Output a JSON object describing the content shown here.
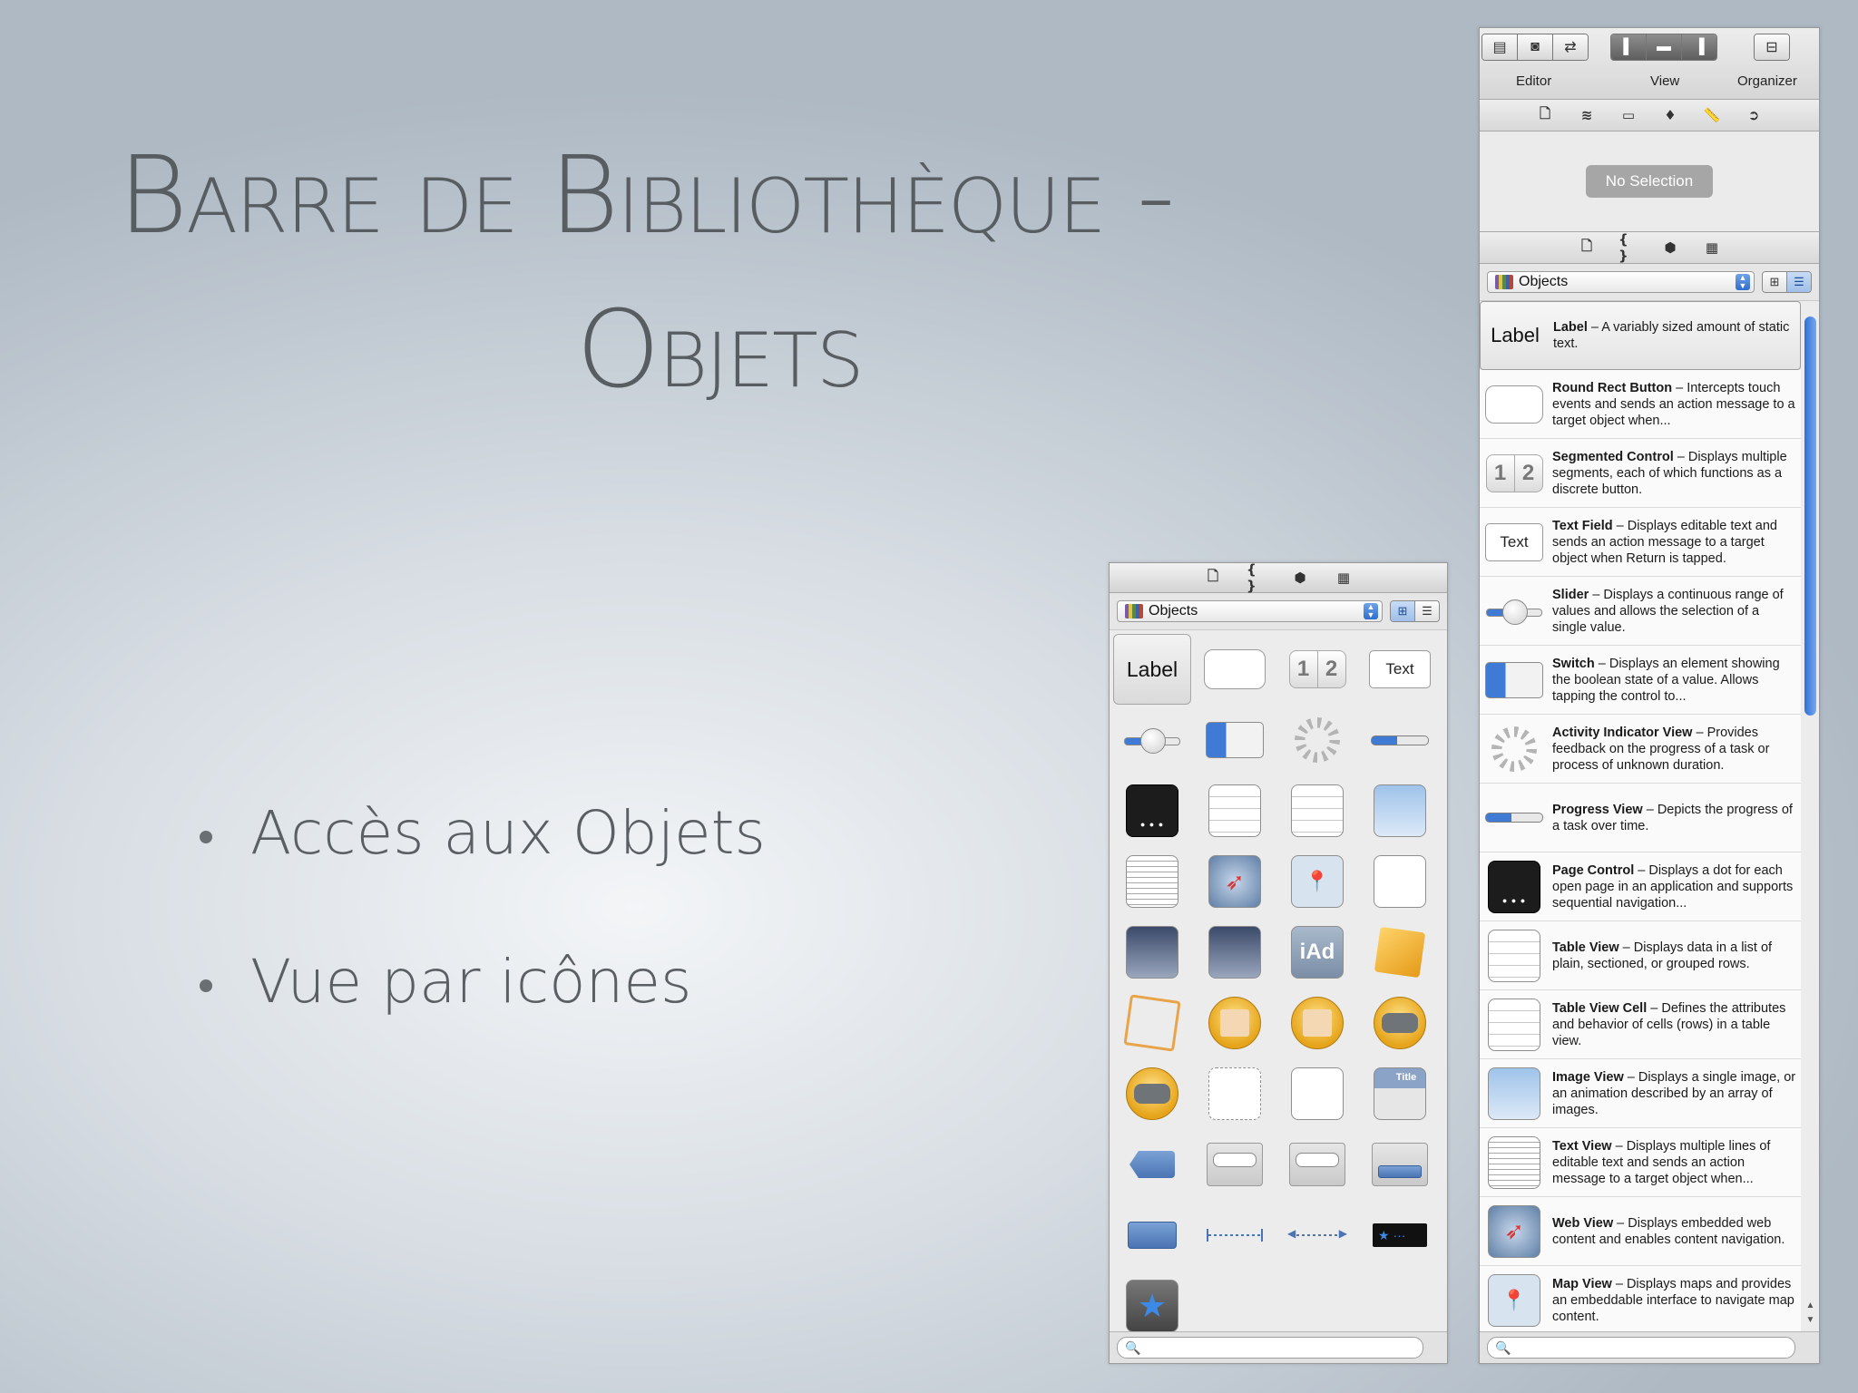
{
  "slide": {
    "title_line1": "Barre de Bibliothèque -",
    "title_line2": "Objets",
    "bullets": [
      "Accès aux Objets",
      "Vue par icônes"
    ]
  },
  "grid_panel": {
    "tabs": [
      "file-icon",
      "braces-icon",
      "cube-icon",
      "film-icon"
    ],
    "popup_label": "Objects",
    "cells": {
      "label": "Label",
      "seg1": "1",
      "seg2": "2",
      "text": "Text",
      "iad": "iAd",
      "title_bar": "Title"
    },
    "search_placeholder": ""
  },
  "right_panel": {
    "toolbar": {
      "editor_label": "Editor",
      "view_label": "View",
      "organizer_label": "Organizer"
    },
    "no_selection": "No Selection",
    "popup_label": "Objects",
    "items": [
      {
        "title": "Label",
        "desc": "A variably sized amount of static text.",
        "icon_text": "Label"
      },
      {
        "title": "Round Rect Button",
        "desc": "Intercepts touch events and sends an action message to a target object when..."
      },
      {
        "title": "Segmented Control",
        "desc": "Displays multiple segments, each of which functions as a discrete button."
      },
      {
        "title": "Text Field",
        "desc": "Displays editable text and sends an action message to a target object when Return is tapped.",
        "icon_text": "Text"
      },
      {
        "title": "Slider",
        "desc": "Displays a continuous range of values and allows the selection of a single value."
      },
      {
        "title": "Switch",
        "desc": "Displays an element showing the boolean state of a value. Allows tapping the control to..."
      },
      {
        "title": "Activity Indicator View",
        "desc": "Provides feedback on the progress of a task or process of unknown duration."
      },
      {
        "title": "Progress View",
        "desc": "Depicts the progress of a task over time."
      },
      {
        "title": "Page Control",
        "desc": "Displays a dot for each open page in an application and supports sequential navigation..."
      },
      {
        "title": "Table View",
        "desc": "Displays data in a list of plain, sectioned, or grouped rows."
      },
      {
        "title": "Table View Cell",
        "desc": "Defines the attributes and behavior of cells (rows) in a table view."
      },
      {
        "title": "Image View",
        "desc": "Displays a single image, or an animation described by an array of images."
      },
      {
        "title": "Text View",
        "desc": "Displays multiple lines of editable text and sends an action message to a target object when..."
      },
      {
        "title": "Web View",
        "desc": "Displays embedded web content and enables content navigation."
      },
      {
        "title": "Map View",
        "desc": "Displays maps and provides an embeddable interface to navigate map content."
      }
    ]
  },
  "colors": {
    "accent": "#3f7bd4",
    "slide_text": "#585d62"
  }
}
